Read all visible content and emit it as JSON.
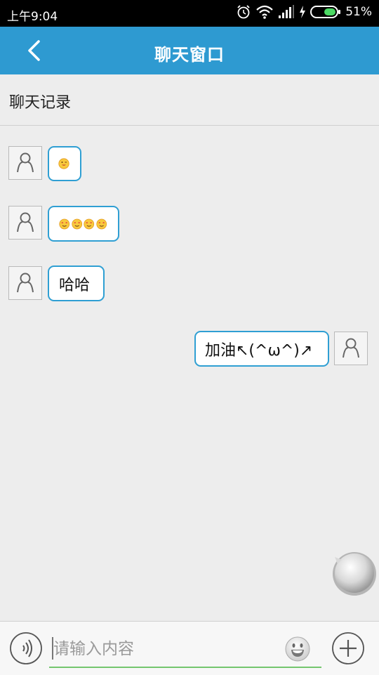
{
  "status_bar": {
    "time": "上午9:04",
    "battery_percent": "51%",
    "icons": [
      "alarm-icon",
      "wifi-icon",
      "signal-icon",
      "charging-icon",
      "battery-icon"
    ]
  },
  "header": {
    "title": "聊天窗口",
    "back_icon": "chevron-left-icon",
    "color": "#2e9ad1"
  },
  "section": {
    "title": "聊天记录"
  },
  "messages": [
    {
      "from": "other",
      "content_type": "emoji",
      "emojis": [
        "tongue-wink-emoji"
      ]
    },
    {
      "from": "other",
      "content_type": "emoji",
      "emojis": [
        "heart-eyes-emoji",
        "heart-eyes-emoji",
        "heart-eyes-emoji",
        "heart-eyes-emoji"
      ]
    },
    {
      "from": "other",
      "content_type": "text",
      "text": "哈哈"
    },
    {
      "from": "self",
      "content_type": "text",
      "text": "加油↖(^ω^)↗"
    }
  ],
  "input_bar": {
    "placeholder": "请输入内容",
    "voice_icon": "voice-icon",
    "emoji_icon": "emoji-icon",
    "add_icon": "plus-icon"
  },
  "floating_button": {
    "icon": "chat-bubble-icon"
  },
  "colors": {
    "accent": "#2e9ad1",
    "bubble_border": "#2f9fd3",
    "input_underline": "#74c66e",
    "background": "#ededed"
  }
}
